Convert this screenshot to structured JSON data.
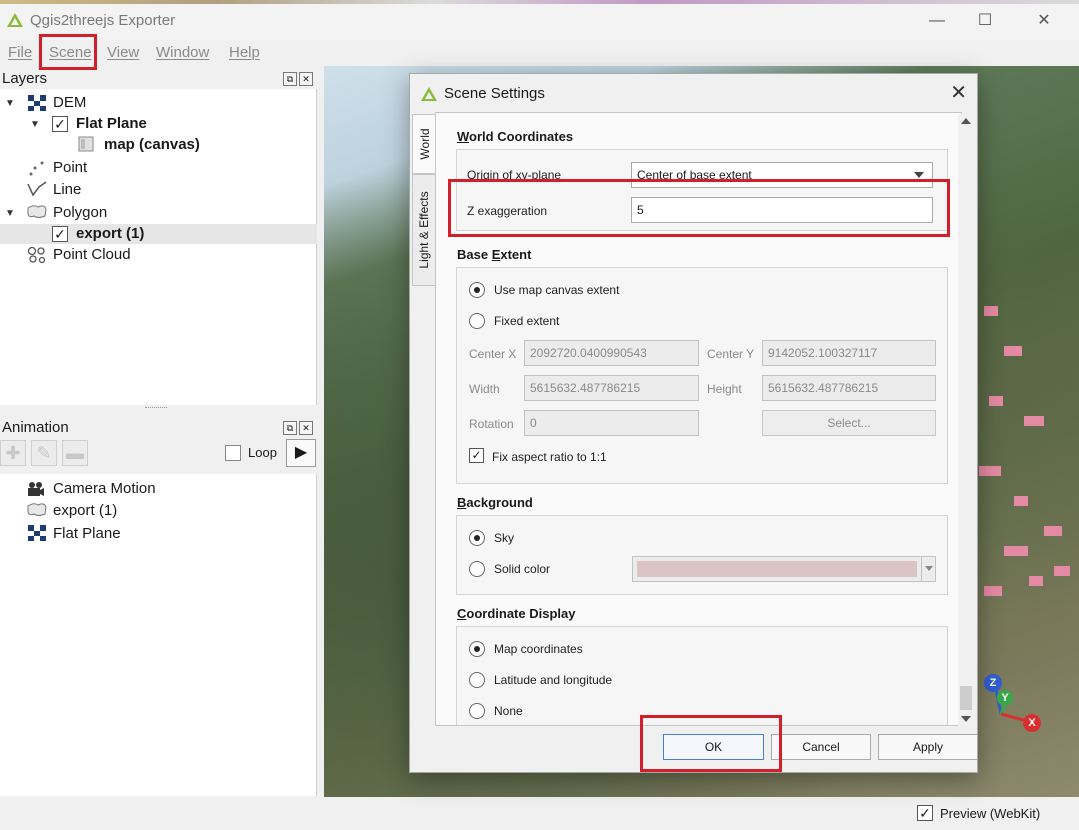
{
  "window": {
    "title": "Qgis2threejs Exporter",
    "controls": {
      "minimize": "—",
      "maximize": "☐",
      "close": "✕"
    }
  },
  "menu": [
    "File",
    "Scene",
    "View",
    "Window",
    "Help"
  ],
  "layers_panel": {
    "title": "Layers",
    "items": [
      {
        "label": "DEM",
        "icon": "dem-grid-icon"
      },
      {
        "label": "Flat Plane",
        "checked": true
      },
      {
        "label": "map (canvas)",
        "icon": "map-canvas-icon"
      },
      {
        "label": "Point",
        "icon": "point-layer-icon"
      },
      {
        "label": "Line",
        "icon": "line-layer-icon"
      },
      {
        "label": "Polygon",
        "icon": "polygon-layer-icon"
      },
      {
        "label": "export (1)",
        "checked": true
      },
      {
        "label": "Point Cloud",
        "icon": "point-cloud-icon"
      }
    ]
  },
  "animation_panel": {
    "title": "Animation",
    "loop_label": "Loop",
    "loop_checked": false,
    "items": [
      {
        "label": "Camera Motion",
        "icon": "camera-icon"
      },
      {
        "label": "export (1)",
        "icon": "polygon-layer-icon"
      },
      {
        "label": "Flat Plane",
        "icon": "dem-grid-icon"
      }
    ]
  },
  "status": {
    "preview_label": "Preview (WebKit)",
    "preview_checked": true
  },
  "dialog": {
    "title": "Scene Settings",
    "tabs": [
      "World",
      "Light & Effects"
    ],
    "world_coordinates": {
      "title_first": "W",
      "title_rest": "orld Coordinates",
      "origin_label": "Origin of xy-plane",
      "origin_value": "Center of base extent",
      "z_label": "Z exaggeration",
      "z_value": "5"
    },
    "base_extent": {
      "title_first": "Base ",
      "title_u": "E",
      "title_rest": "xtent",
      "option_canvas": "Use map canvas extent",
      "option_fixed": "Fixed extent",
      "selected": "Use map canvas extent",
      "center_x_label": "Center X",
      "center_x": "2092720.0400990543",
      "center_y_label": "Center Y",
      "center_y": "9142052.100327117",
      "width_label": "Width",
      "width": "5615632.487786215",
      "height_label": "Height",
      "height": "5615632.487786215",
      "rotation_label": "Rotation",
      "rotation": "0",
      "select_button": "Select...",
      "fix_aspect_label": "Fix aspect ratio to 1:1",
      "fix_aspect_checked": true
    },
    "background": {
      "title_first": "B",
      "title_rest": "ackground",
      "option_sky": "Sky",
      "option_solid": "Solid color",
      "selected": "Sky",
      "swatch_color": "#dcc4c4"
    },
    "coordinate_display": {
      "title_first": "C",
      "title_rest": "oordinate Display",
      "option_map": "Map coordinates",
      "option_latlon": "Latitude and longitude",
      "option_none": "None",
      "selected": "Map coordinates"
    },
    "buttons": {
      "ok": "OK",
      "cancel": "Cancel",
      "apply": "Apply"
    }
  },
  "axes": {
    "z": "Z",
    "y": "Y",
    "x": "X"
  },
  "colors": {
    "highlight": "#d41e2a",
    "building": "#e58aa4"
  }
}
